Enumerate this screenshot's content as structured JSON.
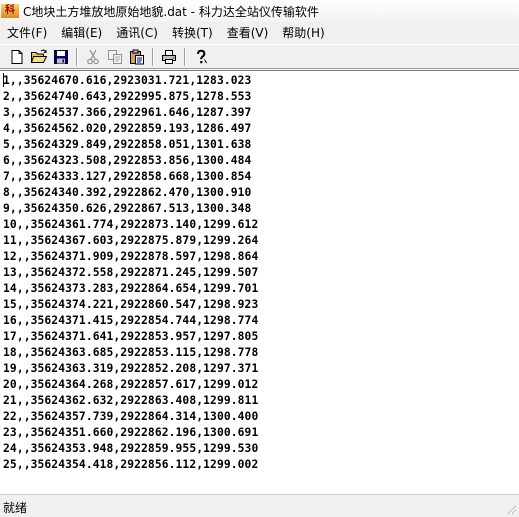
{
  "window": {
    "icon_text": "科达",
    "title": "C地块土方堆放地原始地貌.dat - 科力达全站仪传输软件"
  },
  "menu": [
    {
      "label": "文件(F)"
    },
    {
      "label": "编辑(E)"
    },
    {
      "label": "通讯(C)"
    },
    {
      "label": "转换(T)"
    },
    {
      "label": "查看(V)"
    },
    {
      "label": "帮助(H)"
    }
  ],
  "toolbar": {
    "buttons": [
      {
        "icon": "new-file-icon",
        "enabled": true
      },
      {
        "icon": "open-folder-icon",
        "enabled": true
      },
      {
        "icon": "save-icon",
        "enabled": true
      },
      {
        "icon": "cut-icon",
        "enabled": false
      },
      {
        "icon": "copy-icon",
        "enabled": false
      },
      {
        "icon": "paste-icon",
        "enabled": true
      },
      {
        "icon": "print-icon",
        "enabled": true
      },
      {
        "icon": "help-icon",
        "enabled": true
      }
    ]
  },
  "document": {
    "lines": [
      "1,,35624670.616,2923031.721,1283.023",
      "2,,35624740.643,2922995.875,1278.553",
      "3,,35624537.366,2922961.646,1287.397",
      "4,,35624562.020,2922859.193,1286.497",
      "5,,35624329.849,2922858.051,1301.638",
      "6,,35624323.508,2922853.856,1300.484",
      "7,,35624333.127,2922858.668,1300.854",
      "8,,35624340.392,2922862.470,1300.910",
      "9,,35624350.626,2922867.513,1300.348",
      "10,,35624361.774,2922873.140,1299.612",
      "11,,35624367.603,2922875.879,1299.264",
      "12,,35624371.909,2922878.597,1298.864",
      "13,,35624372.558,2922871.245,1299.507",
      "14,,35624373.283,2922864.654,1299.701",
      "15,,35624374.221,2922860.547,1298.923",
      "16,,35624371.415,2922854.744,1298.774",
      "17,,35624371.641,2922853.957,1297.805",
      "18,,35624363.685,2922853.115,1298.778",
      "19,,35624363.319,2922852.208,1297.371",
      "20,,35624364.268,2922857.617,1299.012",
      "21,,35624362.632,2922863.408,1299.811",
      "22,,35624357.739,2922864.314,1300.400",
      "23,,35624351.660,2922862.196,1300.691",
      "24,,35624353.948,2922859.955,1299.530",
      "25,,35624354.418,2922856.112,1299.002"
    ]
  },
  "statusbar": {
    "text": "就绪"
  }
}
